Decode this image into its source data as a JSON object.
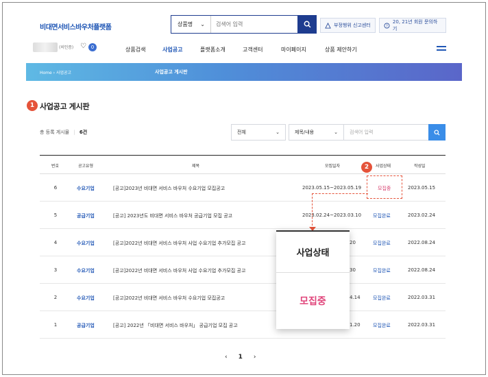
{
  "brand": "비대면서비스바우처플랫폼",
  "search": {
    "category": "상품명",
    "placeholder": "검색어 입력"
  },
  "top_buttons": {
    "report": "부정행위 신고센터",
    "inquiry": "20, 21년 회원 문의하기"
  },
  "user": {
    "name_suffix": "(비인증)",
    "badge": "0"
  },
  "nav": [
    "상품검색",
    "사업공고",
    "플랫폼소개",
    "고객센터",
    "마이페이지",
    "상품 제안하기"
  ],
  "nav_active_index": 1,
  "breadcrumb": {
    "home": "Home",
    "current": "사업공고",
    "title": "사업공고 게시판"
  },
  "page_title": "사업공고 게시판",
  "markers": {
    "one": "1",
    "two": "2"
  },
  "count": {
    "label": "총 등록 게시물",
    "value": "6건"
  },
  "filters": {
    "scope": "전체",
    "field": "제목/내용",
    "placeholder": "검색어 입력"
  },
  "table": {
    "headers": [
      "번호",
      "공고유형",
      "제목",
      "모집일자",
      "사업상태",
      "작성일"
    ],
    "rows": [
      {
        "no": "6",
        "type": "수요기업",
        "title": "[공고]2023년 비대면 서비스 바우처 수요기업 모집공고",
        "period": "2023.05.15~2023.05.19",
        "status": "모집중",
        "date": "2023.05.15"
      },
      {
        "no": "5",
        "type": "공급기업",
        "title": "[공고] 2023년도 비대면 서비스 바우처 공급기업 모집 공고",
        "period": "2023.02.24~2023.03.10",
        "status": "모집완료",
        "date": "2023.02.24"
      },
      {
        "no": "4",
        "type": "수요기업",
        "title": "[공고]2022년 비대면 서비스 바우처 사업 수요기업 추가모집 공고",
        "period": "20",
        "status": "모집완료",
        "date": "2022.08.24"
      },
      {
        "no": "3",
        "type": "수요기업",
        "title": "[공고]2022년 비대면 서비스 바우처 사업 수요기업 추가모집 공고",
        "period": "30",
        "status": "모집완료",
        "date": "2022.08.24"
      },
      {
        "no": "2",
        "type": "수요기업",
        "title": "[공고]2022년 비대면 서비스 바우처 수요기업 모집공고",
        "period": "4.14",
        "status": "모집완료",
        "date": "2022.03.31"
      },
      {
        "no": "1",
        "type": "공급기업",
        "title": "[공고] 2022년 「비대면 서비스 바우처」 공급기업 모집 공고",
        "period": "1.20",
        "status": "모집완료",
        "date": "2022.03.31"
      }
    ]
  },
  "zoom": {
    "header": "사업상태",
    "value": "모집중"
  },
  "pager": {
    "prev": "‹",
    "current": "1",
    "next": "›"
  },
  "colors": {
    "brand_blue": "#1f56b5",
    "accent_red": "#e5533a",
    "recruiting_pink": "#e0457b"
  }
}
